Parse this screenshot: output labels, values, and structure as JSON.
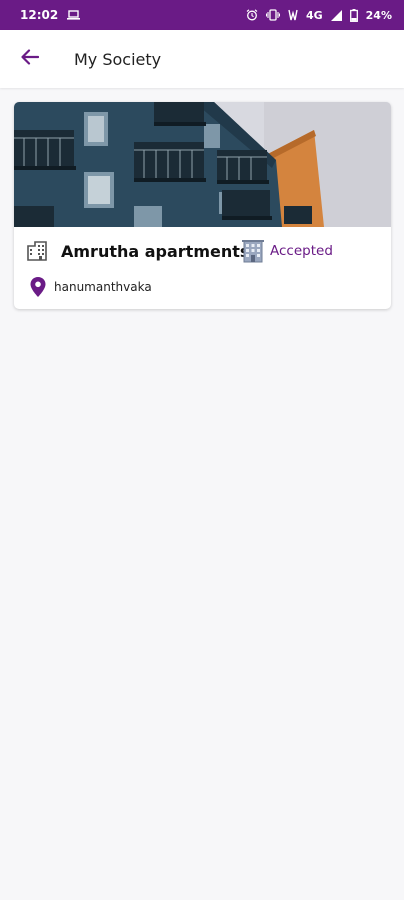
{
  "status_bar": {
    "time": "12:02",
    "network": "4G",
    "battery": "24%"
  },
  "app_bar": {
    "title": "My Society"
  },
  "society_card": {
    "name": "Amrutha apartments",
    "status": "Accepted",
    "location": "hanumanthvaka"
  },
  "colors": {
    "primary": "#6a1b86",
    "background": "#f7f7f9"
  },
  "icons": {
    "back": "arrow-left-icon",
    "building": "building-icon",
    "status": "apartment-block-icon",
    "location": "map-pin-icon"
  }
}
